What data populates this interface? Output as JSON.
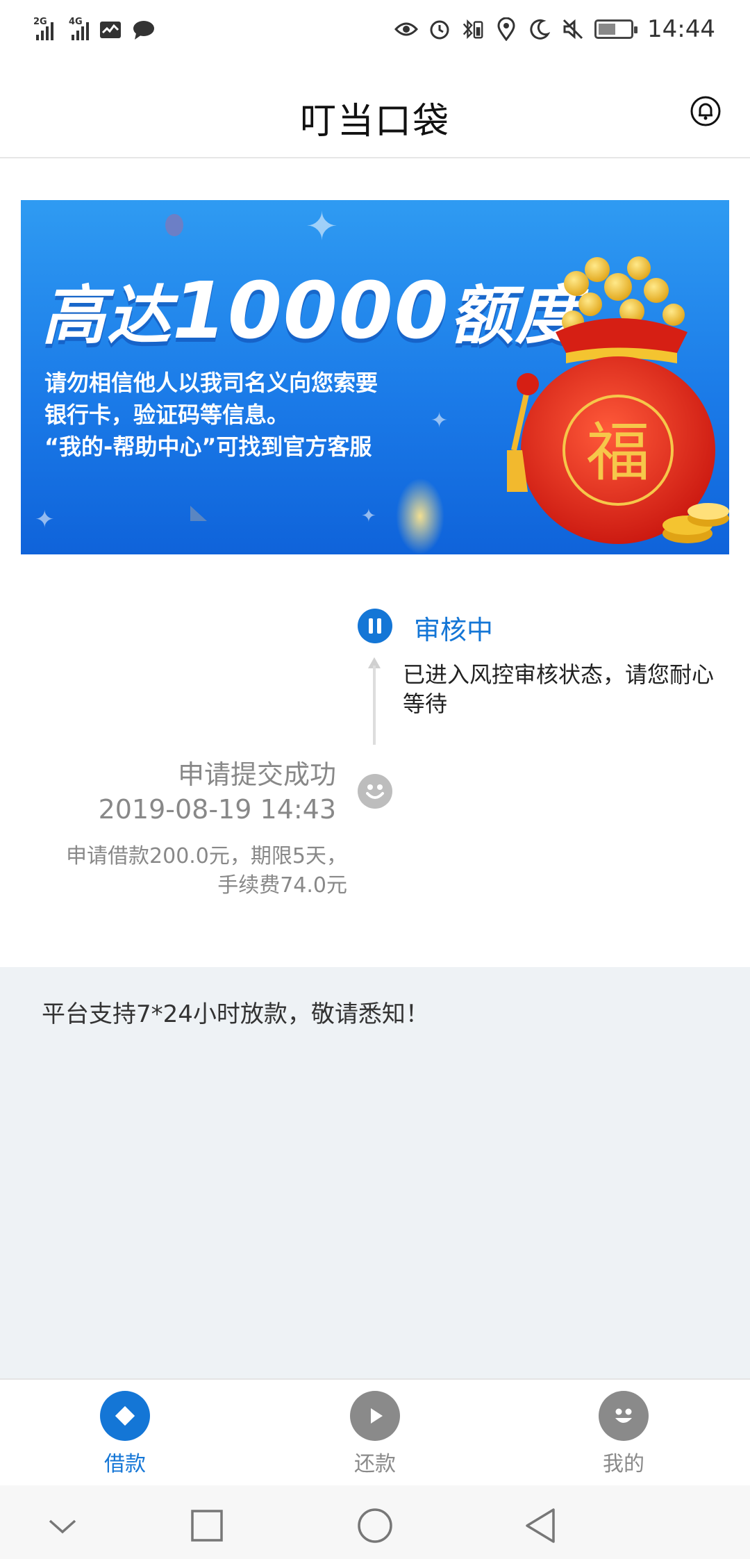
{
  "status_bar": {
    "signal1_tag": "2G",
    "signal2_tag": "4G",
    "time": "14:44"
  },
  "app_bar": {
    "title": "叮当口袋",
    "bell_icon": "bell-icon"
  },
  "banner": {
    "title_prefix": "高达",
    "title_amount": "10000",
    "title_suffix": "额度",
    "lines": [
      "请勿相信他人以我司名义向您索要",
      "银行卡，验证码等信息。",
      "“我的-帮助中心”可找到官方客服"
    ],
    "bag_char": "福"
  },
  "timeline": {
    "current_status": "审核中",
    "current_desc": "已进入风控审核状态，请您耐心等待",
    "submitted_title": "申请提交成功",
    "submitted_time": "2019-08-19 14:43",
    "submitted_detail_line1": "申请借款200.0元，期限5天，",
    "submitted_detail_line2": "手续费74.0元"
  },
  "notice": {
    "text": "平台支持7*24小时放款，敬请悉知！"
  },
  "tabs": [
    {
      "label": "借款",
      "icon": "diamond-icon",
      "active": true
    },
    {
      "label": "还款",
      "icon": "play-icon",
      "active": false
    },
    {
      "label": "我的",
      "icon": "smiley-icon",
      "active": false
    }
  ],
  "colors": {
    "accent": "#1476d6",
    "inactive": "#8a8a8a",
    "notice_bg": "#eef2f5"
  }
}
